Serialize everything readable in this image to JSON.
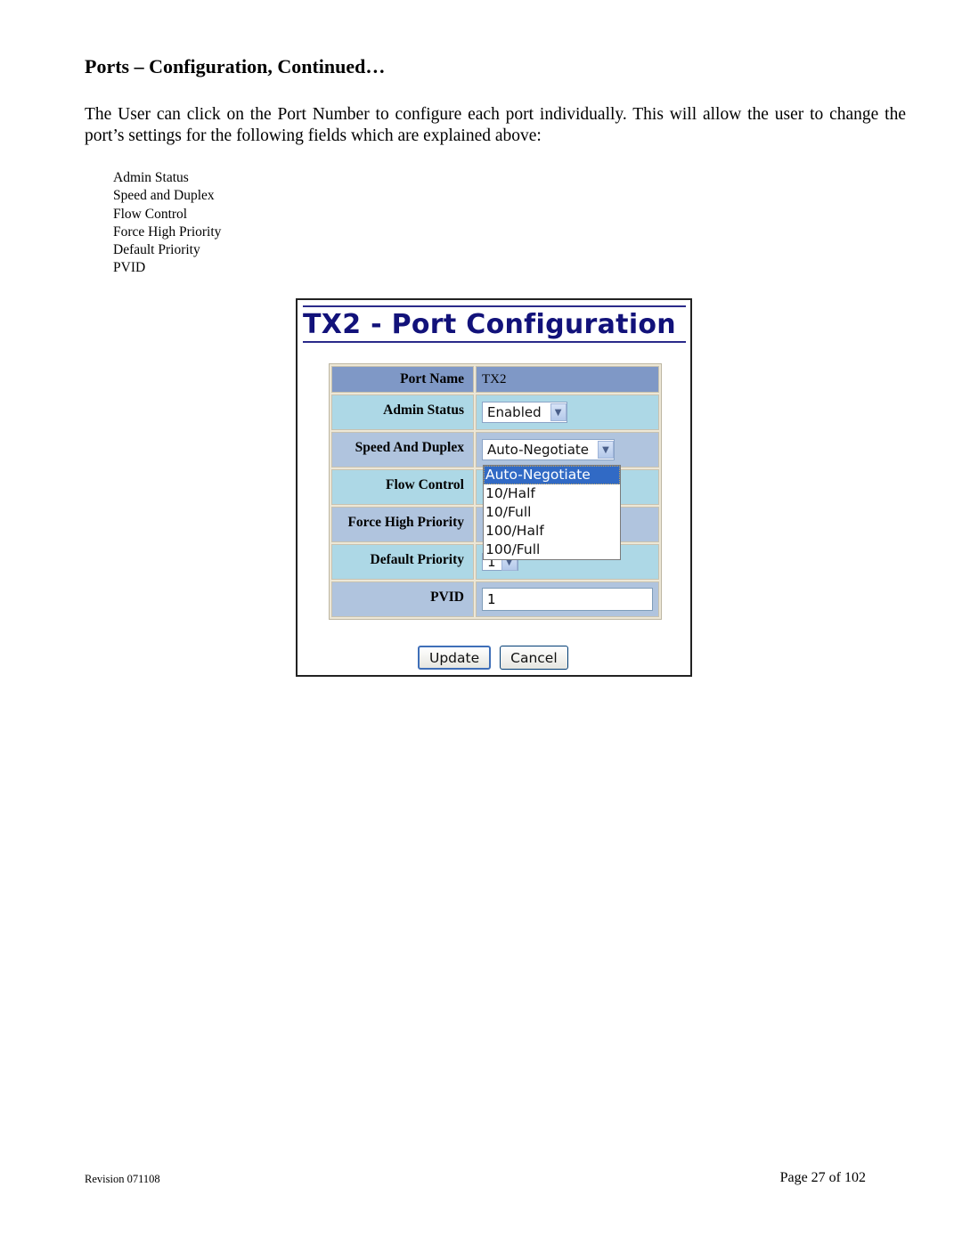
{
  "heading": "Ports – Configuration, Continued…",
  "intro": "The User can click on the Port Number to configure each port individually.  This will allow the user to change the port’s settings for the following fields which are explained above:",
  "fields": [
    "Admin Status",
    "Speed and Duplex",
    "Flow Control",
    "Force High Priority",
    "Default Priority",
    "PVID"
  ],
  "screenshot": {
    "title": "TX2 - Port Configuration",
    "rows": [
      {
        "label": "Port Name",
        "value": "TX2"
      },
      {
        "label": "Admin Status",
        "value": "Enabled"
      },
      {
        "label": "Speed And Duplex",
        "value": "Auto-Negotiate"
      },
      {
        "label": "Flow Control",
        "value": ""
      },
      {
        "label": "Force High Priority",
        "value": ""
      },
      {
        "label": "Default Priority",
        "value": "1"
      },
      {
        "label": "PVID",
        "value": "1"
      }
    ],
    "speed_options": [
      "Auto-Negotiate",
      "10/Half",
      "10/Full",
      "100/Half",
      "100/Full"
    ],
    "speed_selected": "Auto-Negotiate",
    "update_label": "Update",
    "cancel_label": "Cancel",
    "arrow_icon": "⌄"
  },
  "footer": {
    "revision": "Revision 071108",
    "page": "Page 27 of 102"
  }
}
